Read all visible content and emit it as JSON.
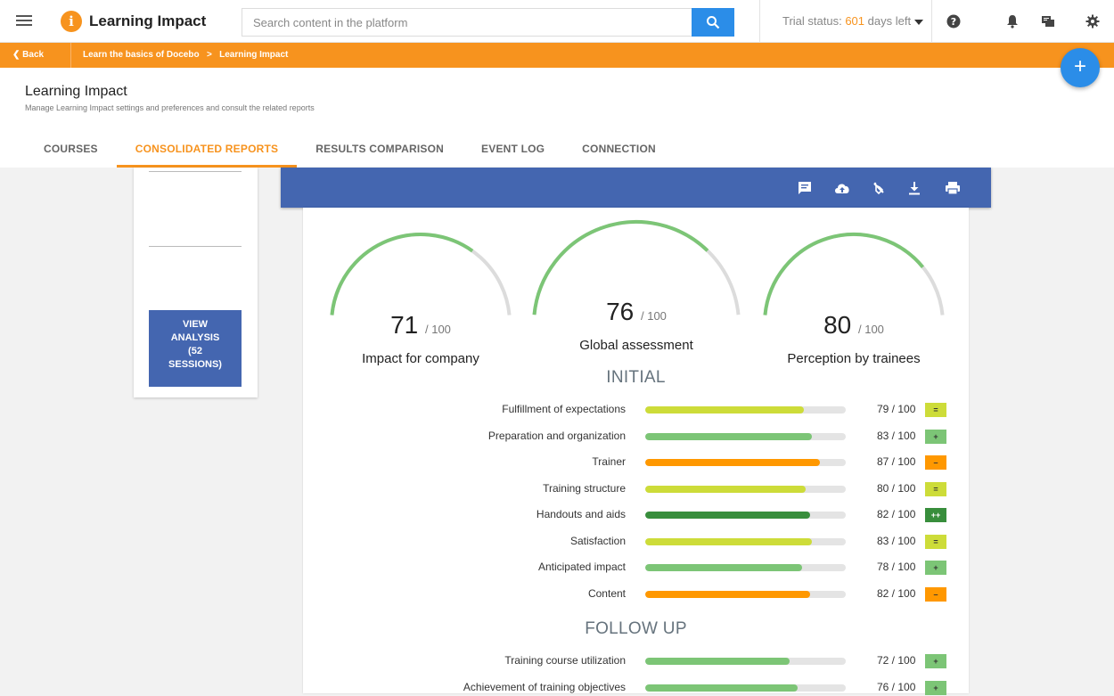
{
  "app": {
    "title": "Learning Impact",
    "logo_letter": "i"
  },
  "search": {
    "placeholder": "Search content in the platform"
  },
  "trial": {
    "prefix": "Trial status: ",
    "days": "601",
    "suffix": " days left"
  },
  "breadcrumb": {
    "back": "Back",
    "items": [
      "Learn the basics of Docebo",
      "Learning Impact"
    ],
    "separator": ">"
  },
  "fab": {
    "label": "+"
  },
  "page": {
    "title": "Learning Impact",
    "subtitle": "Manage Learning Impact settings and preferences and consult the related reports"
  },
  "tabs": [
    {
      "label": "COURSES",
      "active": false
    },
    {
      "label": "CONSOLIDATED REPORTS",
      "active": true
    },
    {
      "label": "RESULTS COMPARISON",
      "active": false
    },
    {
      "label": "EVENT LOG",
      "active": false
    },
    {
      "label": "CONNECTION",
      "active": false
    }
  ],
  "left_card": {
    "button_lines": [
      "VIEW",
      "ANALYSIS",
      "(52",
      "SESSIONS)"
    ]
  },
  "toolbar_icons": [
    "comment-icon",
    "cloud-upload-icon",
    "compare-icon",
    "download-icon",
    "print-icon"
  ],
  "gauges": [
    {
      "value": "71",
      "denom": "/ 100",
      "label": "Impact for company",
      "fraction": 0.71
    },
    {
      "value": "76",
      "denom": "/ 100",
      "label": "Global assessment",
      "fraction": 0.76
    },
    {
      "value": "80",
      "denom": "/ 100",
      "label": "Perception by trainees",
      "fraction": 0.8
    }
  ],
  "sections": {
    "initial": {
      "title": "INITIAL",
      "rows": [
        {
          "label": "Fulfillment of expectations",
          "score": "79 / 100",
          "value": 79,
          "color": "#cddc39",
          "badge": "=",
          "badge_color": "#cddc39"
        },
        {
          "label": "Preparation and organization",
          "score": "83 / 100",
          "value": 83,
          "color": "#7cc576",
          "badge": "+",
          "badge_color": "#7cc576"
        },
        {
          "label": "Trainer",
          "score": "87 / 100",
          "value": 87,
          "color": "#ff9800",
          "badge": "–",
          "badge_color": "#ff9800"
        },
        {
          "label": "Training structure",
          "score": "80 / 100",
          "value": 80,
          "color": "#cddc39",
          "badge": "=",
          "badge_color": "#cddc39"
        },
        {
          "label": "Handouts and aids",
          "score": "82 / 100",
          "value": 82,
          "color": "#388e3c",
          "badge": "++",
          "badge_color": "#388e3c"
        },
        {
          "label": "Satisfaction",
          "score": "83 / 100",
          "value": 83,
          "color": "#cddc39",
          "badge": "=",
          "badge_color": "#cddc39"
        },
        {
          "label": "Anticipated impact",
          "score": "78 / 100",
          "value": 78,
          "color": "#7cc576",
          "badge": "+",
          "badge_color": "#7cc576"
        },
        {
          "label": "Content",
          "score": "82 / 100",
          "value": 82,
          "color": "#ff9800",
          "badge": "–",
          "badge_color": "#ff9800"
        }
      ]
    },
    "follow_up": {
      "title": "FOLLOW UP",
      "rows": [
        {
          "label": "Training course utilization",
          "score": "72 / 100",
          "value": 72,
          "color": "#7cc576",
          "badge": "+",
          "badge_color": "#7cc576"
        },
        {
          "label": "Achievement of training objectives",
          "score": "76 / 100",
          "value": 76,
          "color": "#7cc576",
          "badge": "+",
          "badge_color": "#7cc576"
        }
      ]
    }
  },
  "colors": {
    "accent": "#f7931e",
    "primary": "#2b8de8",
    "report_bar": "#4466b0",
    "gauge_track": "#dcdcdc",
    "gauge_fill": "#7cc576"
  }
}
